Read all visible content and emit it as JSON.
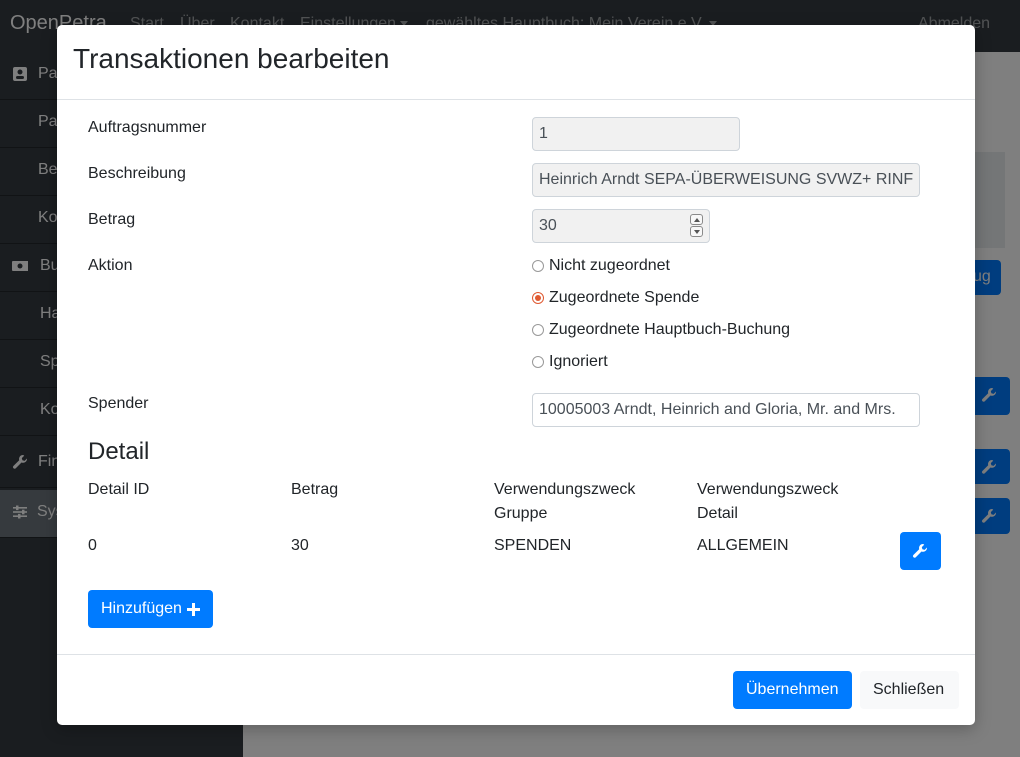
{
  "navbar": {
    "brand": "OpenPetra",
    "links": [
      "Start",
      "Über",
      "Kontakt",
      "Einstellungen",
      "gewähltes Hauptbuch: Mein Verein e.V."
    ],
    "logout": "Abmelden"
  },
  "sidebar": {
    "items": [
      {
        "label": "Partner",
        "icon": "address-card-icon"
      },
      {
        "label": "Partner suchen"
      },
      {
        "label": "Beiträge"
      },
      {
        "label": "Kontakte"
      },
      {
        "label": "Buchhaltung",
        "icon": "money-bill-icon"
      },
      {
        "label": "Hauptbuch"
      },
      {
        "label": "Spenden"
      },
      {
        "label": "Konten"
      },
      {
        "label": "Finanzen",
        "icon": "wrench-icon"
      },
      {
        "label": "System",
        "icon": "sliders-icon"
      }
    ]
  },
  "background": {
    "button_fragment": "ug"
  },
  "modal": {
    "title": "Transaktionen bearbeiten",
    "fields": {
      "auftragsnummer": {
        "label": "Auftragsnummer",
        "value": "1"
      },
      "beschreibung": {
        "label": "Beschreibung",
        "value": "Heinrich Arndt SEPA-ÜBERWEISUNG SVWZ+ RINF"
      },
      "betrag": {
        "label": "Betrag",
        "value": "30"
      },
      "aktion": {
        "label": "Aktion",
        "options": [
          "Nicht zugeordnet",
          "Zugeordnete Spende",
          "Zugeordnete Hauptbuch-Buchung",
          "Ignoriert"
        ],
        "selected": "Zugeordnete Spende"
      },
      "spender": {
        "label": "Spender",
        "value": "10005003 Arndt, Heinrich and Gloria, Mr. and Mrs."
      }
    },
    "detail": {
      "title": "Detail",
      "columns": [
        "Detail ID",
        "Betrag",
        "Verwendungszweck Gruppe",
        "Verwendungszweck Detail"
      ],
      "rows": [
        {
          "detail_id": "0",
          "betrag": "30",
          "gruppe": "SPENDEN",
          "detail": "ALLGEMEIN"
        }
      ]
    },
    "add_button": "Hinzufügen",
    "apply_button": "Übernehmen",
    "close_button": "Schließen"
  },
  "colors": {
    "primary": "#007bff",
    "navbar": "#343a40",
    "radio_checked": "#e05a32"
  }
}
